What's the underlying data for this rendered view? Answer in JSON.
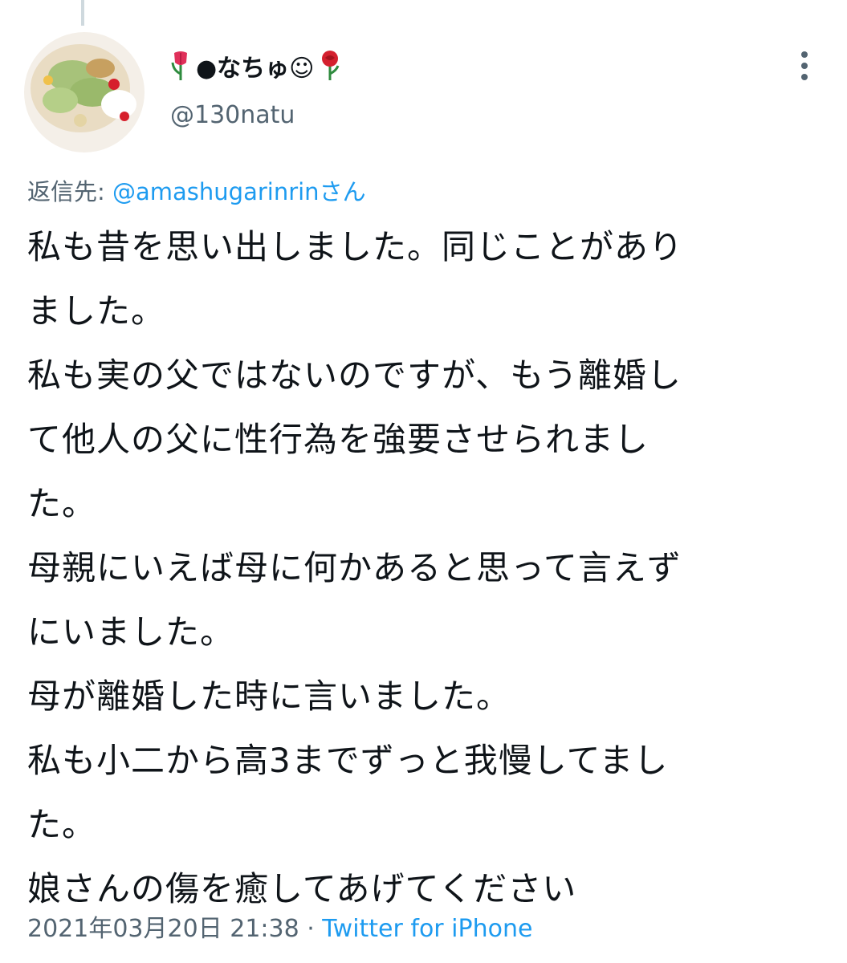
{
  "tweet": {
    "display_name": "●なちゅ☺",
    "handle": "@130natu",
    "reply_label": "返信先: ",
    "reply_mention": "@amashugarinrin",
    "reply_suffix": "さん",
    "body_lines": [
      "私も昔を思い出しました。同じことがあり",
      "ました。",
      "私も実の父ではないのですが、もう離婚し",
      "て他人の父に性行為を強要させられまし",
      "た。",
      "母親にいえば母に何かあると思って言えず",
      "にいました。",
      "母が離婚した時に言いました。",
      "私も小二から高3までずっと我慢してまし",
      "た。",
      "娘さんの傷を癒してあげてください"
    ],
    "timestamp": "2021年03月20日 21:38",
    "separator": " · ",
    "source": "Twitter for iPhone"
  },
  "icons": {
    "more": "more-vertical-icon",
    "tulip": "tulip-icon",
    "rose": "rose-icon"
  },
  "colors": {
    "accent": "#1d9bf0",
    "secondary_text": "#536471",
    "primary_text": "#0f1419"
  }
}
